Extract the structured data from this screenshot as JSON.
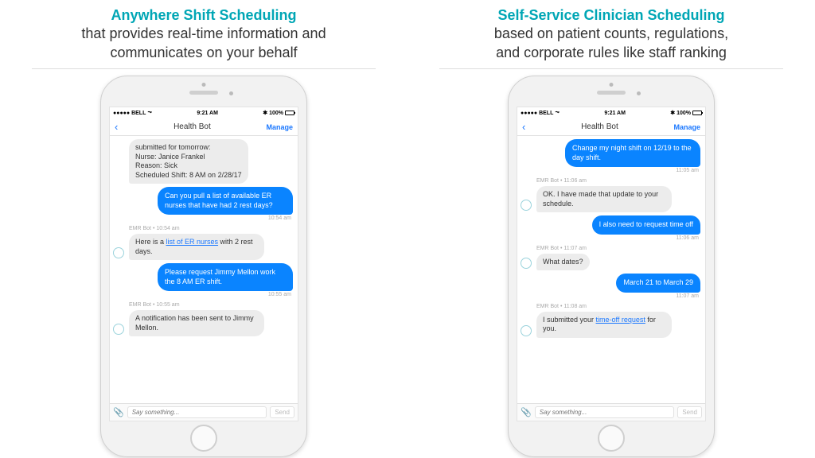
{
  "left": {
    "title": "Anywhere Shift Scheduling",
    "subtitle1": "that provides real-time information and",
    "subtitle2": "communicates on your behalf",
    "status": {
      "carrier": "●●●●● BELL",
      "wifi": "⏦",
      "time": "9:21 AM",
      "bt": "✱",
      "batt": "100%"
    },
    "nav": {
      "title": "Health Bot",
      "manage": "Manage"
    },
    "messages": {
      "m0": {
        "line1": "submitted for tomorrow:",
        "line2": "Nurse: Janice Frankel",
        "line3": "Reason: Sick",
        "line4": "Scheduled Shift: 8 AM on 2/28/17"
      },
      "u1": {
        "text": "Can you pull a list of available ER nurses that have had 2 rest days?",
        "ts": "10:54 am"
      },
      "b1": {
        "meta": "EMR Bot • 10:54 am",
        "pre": "Here is a ",
        "link": "list of ER nurses",
        "post": " with 2 rest days."
      },
      "u2": {
        "text": "Please request Jimmy Mellon work the 8 AM ER shift.",
        "ts": "10:55 am"
      },
      "b2": {
        "meta": "EMR Bot • 10:55 am",
        "text": "A notification has been sent to Jimmy Mellon."
      }
    },
    "input": {
      "placeholder": "Say something...",
      "send": "Send"
    }
  },
  "right": {
    "title": "Self-Service Clinician Scheduling",
    "subtitle1": "based on patient counts, regulations,",
    "subtitle2": "and corporate rules like staff ranking",
    "status": {
      "carrier": "●●●●● BELL",
      "wifi": "⏦",
      "time": "9:21 AM",
      "bt": "✱",
      "batt": "100%"
    },
    "nav": {
      "title": "Health Bot",
      "manage": "Manage"
    },
    "messages": {
      "u1": {
        "text": "Change my night shift on 12/19 to the day shift.",
        "ts": "11:05 am"
      },
      "b1": {
        "meta": "EMR Bot • 11:06 am",
        "text": "OK. I have made that update to your schedule."
      },
      "u2": {
        "text": "I also need to request time off",
        "ts": "11:06 am"
      },
      "b2": {
        "meta": "EMR Bot • 11:07 am",
        "text": "What dates?"
      },
      "u3": {
        "text": "March 21 to March 29",
        "ts": "11:07 am"
      },
      "b3": {
        "meta": "EMR Bot • 11:08 am",
        "pre": "I submitted your ",
        "link": "time-off request",
        "post": " for you."
      }
    },
    "input": {
      "placeholder": "Say something...",
      "send": "Send"
    }
  }
}
